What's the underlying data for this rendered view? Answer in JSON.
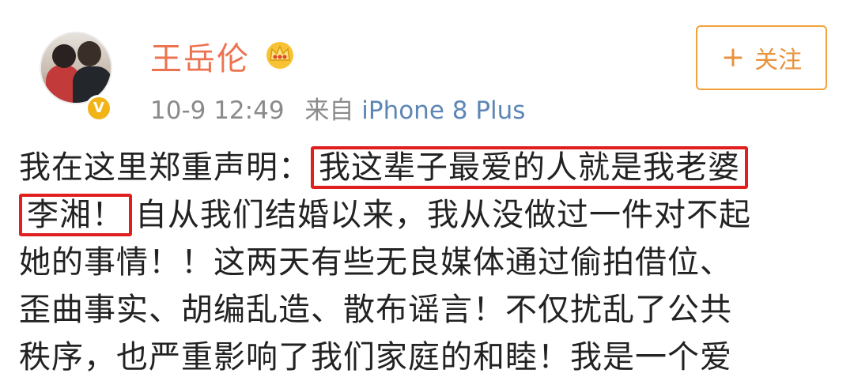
{
  "user": {
    "name": "王岳伦",
    "verified_badge": "V"
  },
  "post_meta": {
    "time": "10-9 12:49",
    "from_label": "来自",
    "source": "iPhone 8 Plus"
  },
  "follow_button": {
    "icon": "+",
    "label": "关注"
  },
  "post": {
    "line1_pre": "我在这里郑重声明：",
    "line1_hl": "我这辈子最爱的人就是我老婆",
    "line2_hl": "李湘！",
    "line2_rest": "自从我们结婚以来，我从没做过一件对不起",
    "line3": "她的事情！！这两天有些无良媒体通过偷拍借位、",
    "line4": "歪曲事实、胡编乱造、散布谣言！不仅扰乱了公共",
    "line5": "秩序，也严重影响了我们家庭的和睦！我是一个爱"
  },
  "colors": {
    "username": "#eb7350",
    "highlight_box": "#e01f1f",
    "follow": "#e8923b",
    "source_link": "#5d86b5"
  }
}
